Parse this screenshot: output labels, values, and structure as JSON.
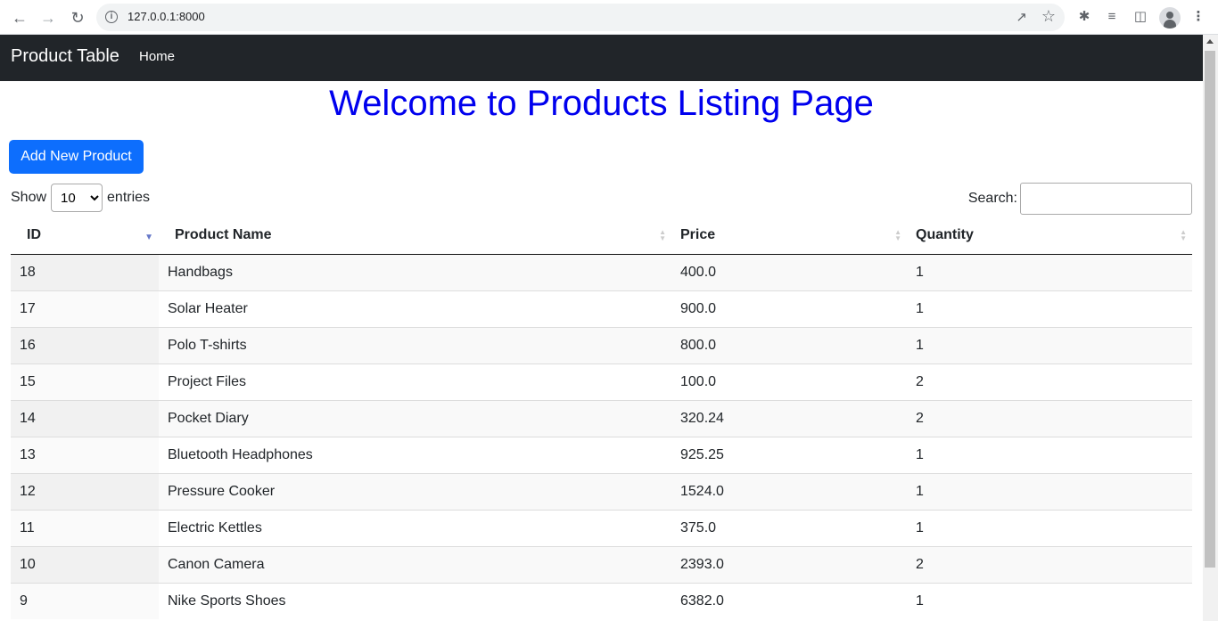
{
  "browser": {
    "url": "127.0.0.1:8000"
  },
  "navbar": {
    "brand": "Product Table",
    "home_link": "Home"
  },
  "page": {
    "heading": "Welcome to Products Listing Page",
    "add_button_label": "Add New Product",
    "show_label": "Show",
    "entries_label": "entries",
    "entries_selected": "10",
    "search_label": "Search:",
    "search_value": ""
  },
  "table": {
    "columns": [
      "ID",
      "Product Name",
      "Price",
      "Quantity"
    ],
    "sorted_column": "ID",
    "sort_direction": "descending",
    "rows": [
      [
        "18",
        "Handbags",
        "400.0",
        "1"
      ],
      [
        "17",
        "Solar Heater",
        "900.0",
        "1"
      ],
      [
        "16",
        "Polo T-shirts",
        "800.0",
        "1"
      ],
      [
        "15",
        "Project Files",
        "100.0",
        "2"
      ],
      [
        "14",
        "Pocket Diary",
        "320.24",
        "2"
      ],
      [
        "13",
        "Bluetooth Headphones",
        "925.25",
        "1"
      ],
      [
        "12",
        "Pressure Cooker",
        "1524.0",
        "1"
      ],
      [
        "11",
        "Electric Kettles",
        "375.0",
        "1"
      ],
      [
        "10",
        "Canon Camera",
        "2393.0",
        "2"
      ],
      [
        "9",
        "Nike Sports Shoes",
        "6382.0",
        "1"
      ]
    ]
  },
  "colors": {
    "navbar_bg": "#212529",
    "heading": "#0000ee",
    "primary_button": "#0d6efd"
  }
}
